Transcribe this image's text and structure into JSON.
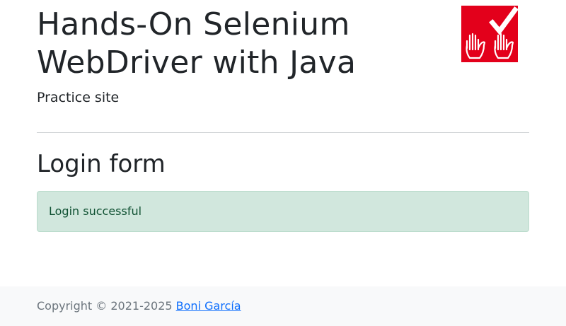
{
  "header": {
    "title_line1": "Hands-On Selenium",
    "title_line2": "WebDriver with Java",
    "subtitle": "Practice site"
  },
  "logo": {
    "icon": "hands-checkmark-logo",
    "background_color": "#e3001b"
  },
  "main": {
    "section_title": "Login form",
    "alert_message": "Login successful",
    "alert_color": "#d1e7dd"
  },
  "footer": {
    "copyright_text": "Copyright © 2021-2025",
    "author_link": "Boni García",
    "link_color": "#0d6efd"
  }
}
